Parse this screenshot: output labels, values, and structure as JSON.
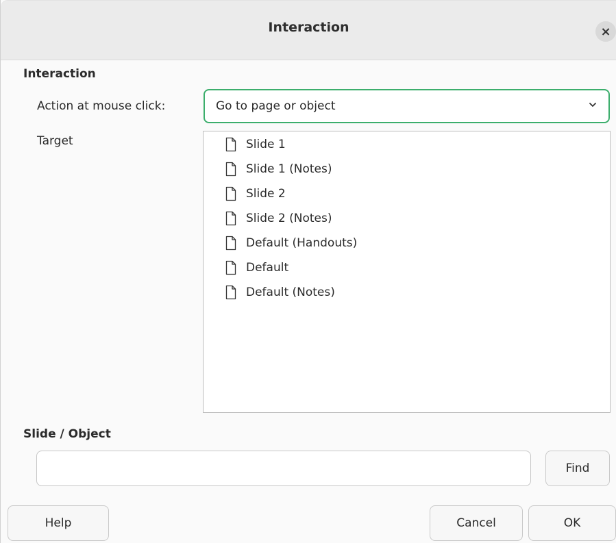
{
  "window": {
    "title": "Interaction",
    "close_glyph": "×"
  },
  "interaction_section": {
    "heading": "Interaction",
    "action_label": "Action at mouse click:",
    "action_value": "Go to page or object",
    "target_label": "Target",
    "targets": [
      {
        "label": "Slide 1",
        "icon": "page-icon"
      },
      {
        "label": "Slide 1 (Notes)",
        "icon": "page-icon"
      },
      {
        "label": "Slide 2",
        "icon": "page-icon"
      },
      {
        "label": "Slide 2 (Notes)",
        "icon": "page-icon"
      },
      {
        "label": "Default (Handouts)",
        "icon": "page-icon"
      },
      {
        "label": "Default",
        "icon": "page-icon"
      },
      {
        "label": "Default (Notes)",
        "icon": "page-icon"
      }
    ]
  },
  "slide_object_section": {
    "heading": "Slide / Object",
    "input_value": "",
    "find_label": "Find"
  },
  "buttons": {
    "help": "Help",
    "cancel": "Cancel",
    "ok": "OK"
  },
  "colors": {
    "focus_border": "#3cae6c",
    "titlebar_bg": "#ebebeb"
  }
}
